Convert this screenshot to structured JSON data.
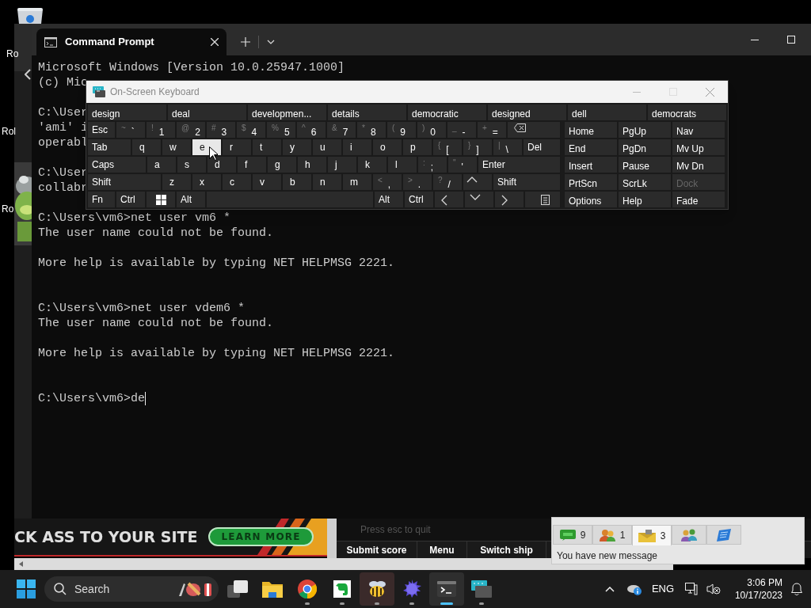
{
  "desktop_icons": [
    {
      "label": "Ro"
    },
    {
      "label": "Rol"
    },
    {
      "label": "Ro"
    }
  ],
  "terminal": {
    "tab_title": "Command Prompt",
    "lines": [
      {
        "kind": "text",
        "text": "Microsoft Windows [Version 10.0.25947.1000]"
      },
      {
        "kind": "text",
        "text": "(c) Mic"
      },
      {
        "kind": "blank"
      },
      {
        "kind": "text",
        "text": "C:\\User"
      },
      {
        "kind": "text",
        "text": "'ami' i"
      },
      {
        "kind": "text",
        "text": "operabl"
      },
      {
        "kind": "blank"
      },
      {
        "kind": "text",
        "text": "C:\\User"
      },
      {
        "kind": "text",
        "text": "collabr"
      },
      {
        "kind": "blank"
      },
      {
        "kind": "text",
        "text": "C:\\Users\\vm6>net user vm6 *"
      },
      {
        "kind": "text",
        "text": "The user name could not be found."
      },
      {
        "kind": "blank"
      },
      {
        "kind": "text",
        "text": "More help is available by typing NET HELPMSG 2221."
      },
      {
        "kind": "blank"
      },
      {
        "kind": "blank"
      },
      {
        "kind": "text",
        "text": "C:\\Users\\vm6>net user vdem6 *"
      },
      {
        "kind": "text",
        "text": "The user name could not be found."
      },
      {
        "kind": "blank"
      },
      {
        "kind": "text",
        "text": "More help is available by typing NET HELPMSG 2221."
      },
      {
        "kind": "blank"
      },
      {
        "kind": "blank"
      },
      {
        "kind": "input",
        "text": "C:\\Users\\vm6>de"
      }
    ]
  },
  "keyboard": {
    "title": "On-Screen Keyboard",
    "predictions": [
      "design",
      "deal",
      "developmen...",
      "details",
      "democratic",
      "designed",
      "dell",
      "democrats"
    ],
    "number_row": [
      {
        "kind": "label",
        "label": "Esc",
        "highlighted": false
      },
      {
        "kind": "dual",
        "shift": "~",
        "label": "`",
        "highlighted": false
      },
      {
        "kind": "dual",
        "shift": "!",
        "label": "1",
        "highlighted": false
      },
      {
        "kind": "dual",
        "shift": "@",
        "label": "2",
        "highlighted": false
      },
      {
        "kind": "dual",
        "shift": "#",
        "label": "3",
        "highlighted": false
      },
      {
        "kind": "dual",
        "shift": "$",
        "label": "4",
        "highlighted": false
      },
      {
        "kind": "dual",
        "shift": "%",
        "label": "5",
        "highlighted": false
      },
      {
        "kind": "dual",
        "shift": "^",
        "label": "6",
        "highlighted": false
      },
      {
        "kind": "dual",
        "shift": "&",
        "label": "7",
        "highlighted": false
      },
      {
        "kind": "dual",
        "shift": "*",
        "label": "8",
        "highlighted": false
      },
      {
        "kind": "dual",
        "shift": "(",
        "label": "9",
        "highlighted": false
      },
      {
        "kind": "dual",
        "shift": ")",
        "label": "0",
        "highlighted": false
      },
      {
        "kind": "dual",
        "shift": "_",
        "label": "-",
        "highlighted": false
      },
      {
        "kind": "dual",
        "shift": "+",
        "label": "=",
        "highlighted": false
      },
      {
        "kind": "backspace",
        "highlighted": false
      }
    ],
    "top_row": [
      {
        "kind": "label",
        "label": "Tab",
        "highlighted": false
      },
      {
        "kind": "char",
        "label": "q",
        "highlighted": false
      },
      {
        "kind": "char",
        "label": "w",
        "highlighted": false
      },
      {
        "kind": "char",
        "label": "e",
        "highlighted": true
      },
      {
        "kind": "char",
        "label": "r",
        "highlighted": false
      },
      {
        "kind": "char",
        "label": "t",
        "highlighted": false
      },
      {
        "kind": "char",
        "label": "y",
        "highlighted": false
      },
      {
        "kind": "char",
        "label": "u",
        "highlighted": false
      },
      {
        "kind": "char",
        "label": "i",
        "highlighted": false
      },
      {
        "kind": "char",
        "label": "o",
        "highlighted": false
      },
      {
        "kind": "char",
        "label": "p",
        "highlighted": false
      },
      {
        "kind": "dual",
        "shift": "{",
        "label": "[",
        "highlighted": false
      },
      {
        "kind": "dual",
        "shift": "}",
        "label": "]",
        "highlighted": false
      },
      {
        "kind": "dual",
        "shift": "|",
        "label": "\\",
        "highlighted": false
      },
      {
        "kind": "label",
        "label": "Del",
        "highlighted": false
      }
    ],
    "home_row": [
      {
        "kind": "label",
        "label": "Caps",
        "highlighted": false
      },
      {
        "kind": "char",
        "label": "a",
        "highlighted": false
      },
      {
        "kind": "char",
        "label": "s",
        "highlighted": false
      },
      {
        "kind": "char",
        "label": "d",
        "highlighted": false
      },
      {
        "kind": "char",
        "label": "f",
        "highlighted": false
      },
      {
        "kind": "char",
        "label": "g",
        "highlighted": false
      },
      {
        "kind": "char",
        "label": "h",
        "highlighted": false
      },
      {
        "kind": "char",
        "label": "j",
        "highlighted": false
      },
      {
        "kind": "char",
        "label": "k",
        "highlighted": false
      },
      {
        "kind": "char",
        "label": "l",
        "highlighted": false
      },
      {
        "kind": "dual",
        "shift": ":",
        "label": ";",
        "highlighted": false
      },
      {
        "kind": "dual",
        "shift": "\"",
        "label": "'",
        "highlighted": false
      },
      {
        "kind": "label",
        "label": "Enter",
        "highlighted": false
      }
    ],
    "bottom_row": [
      {
        "kind": "label",
        "label": "Shift",
        "highlighted": false
      },
      {
        "kind": "char",
        "label": "z",
        "highlighted": false
      },
      {
        "kind": "char",
        "label": "x",
        "highlighted": false
      },
      {
        "kind": "char",
        "label": "c",
        "highlighted": false
      },
      {
        "kind": "char",
        "label": "v",
        "highlighted": false
      },
      {
        "kind": "char",
        "label": "b",
        "highlighted": false
      },
      {
        "kind": "char",
        "label": "n",
        "highlighted": false
      },
      {
        "kind": "char",
        "label": "m",
        "highlighted": false
      },
      {
        "kind": "dual",
        "shift": "<",
        "label": ",",
        "highlighted": false
      },
      {
        "kind": "dual",
        "shift": ">",
        "label": ".",
        "highlighted": false
      },
      {
        "kind": "dual",
        "shift": "?",
        "label": "/",
        "highlighted": false
      },
      {
        "kind": "up",
        "highlighted": false
      },
      {
        "kind": "label",
        "label": "Shift",
        "highlighted": false
      }
    ],
    "space_row": [
      {
        "kind": "label",
        "label": "Fn",
        "highlighted": false
      },
      {
        "kind": "label",
        "label": "Ctrl",
        "highlighted": false
      },
      {
        "kind": "windows",
        "highlighted": false
      },
      {
        "kind": "label",
        "label": "Alt",
        "highlighted": false
      },
      {
        "kind": "space",
        "highlighted": false
      },
      {
        "kind": "label",
        "label": "Alt",
        "highlighted": false
      },
      {
        "kind": "label",
        "label": "Ctrl",
        "highlighted": false
      },
      {
        "kind": "left",
        "highlighted": false
      },
      {
        "kind": "down",
        "highlighted": false
      },
      {
        "kind": "right",
        "highlighted": false
      },
      {
        "kind": "menu",
        "highlighted": false
      }
    ],
    "nav_rows": [
      [
        {
          "label": "Home",
          "disabled": false
        },
        {
          "label": "PgUp",
          "disabled": false
        },
        {
          "label": "Nav",
          "disabled": false
        }
      ],
      [
        {
          "label": "End",
          "disabled": false
        },
        {
          "label": "PgDn",
          "disabled": false
        },
        {
          "label": "Mv Up",
          "disabled": false
        }
      ],
      [
        {
          "label": "Insert",
          "disabled": false
        },
        {
          "label": "Pause",
          "disabled": false
        },
        {
          "label": "Mv Dn",
          "disabled": false
        }
      ],
      [
        {
          "label": "PrtScn",
          "disabled": false
        },
        {
          "label": "ScrLk",
          "disabled": false
        },
        {
          "label": "Dock",
          "disabled": true
        }
      ],
      [
        {
          "label": "Options",
          "disabled": false
        },
        {
          "label": "Help",
          "disabled": false
        },
        {
          "label": "Fade",
          "disabled": false
        }
      ]
    ]
  },
  "browser": {
    "ad": {
      "headline": "CK ASS TO YOUR SITE",
      "button": "LEARN MORE"
    },
    "game": {
      "hint": "Press esc to quit",
      "buttons": [
        "Submit score",
        "Menu",
        "Switch ship"
      ]
    }
  },
  "notification": {
    "tabs": [
      {
        "kind": "chat",
        "count": "9",
        "selected": false
      },
      {
        "kind": "contacts",
        "count": "1",
        "selected": false
      },
      {
        "kind": "mail",
        "count": "3",
        "selected": true
      },
      {
        "kind": "group",
        "selected": false
      },
      {
        "kind": "note",
        "selected": false
      }
    ],
    "message": "You have new message"
  },
  "taskbar": {
    "search": "Search",
    "apps": [
      {
        "kind": "task-view",
        "running": false,
        "active": false,
        "highlighted": false
      },
      {
        "kind": "folder",
        "running": false,
        "active": false,
        "highlighted": false
      },
      {
        "kind": "browser",
        "running": true,
        "active": false,
        "highlighted": false
      },
      {
        "kind": "note",
        "running": true,
        "active": false,
        "highlighted": false
      },
      {
        "kind": "bee",
        "running": true,
        "active": false,
        "highlighted": true
      },
      {
        "kind": "ball",
        "running": true,
        "active": false,
        "highlighted": false
      },
      {
        "kind": "terminal",
        "running": true,
        "active": true,
        "highlighted": false
      },
      {
        "kind": "keyboard",
        "running": true,
        "active": false,
        "highlighted": false
      }
    ],
    "tray": {
      "language": "ENG",
      "time": "3:06 PM",
      "date": "10/17/2023"
    }
  }
}
